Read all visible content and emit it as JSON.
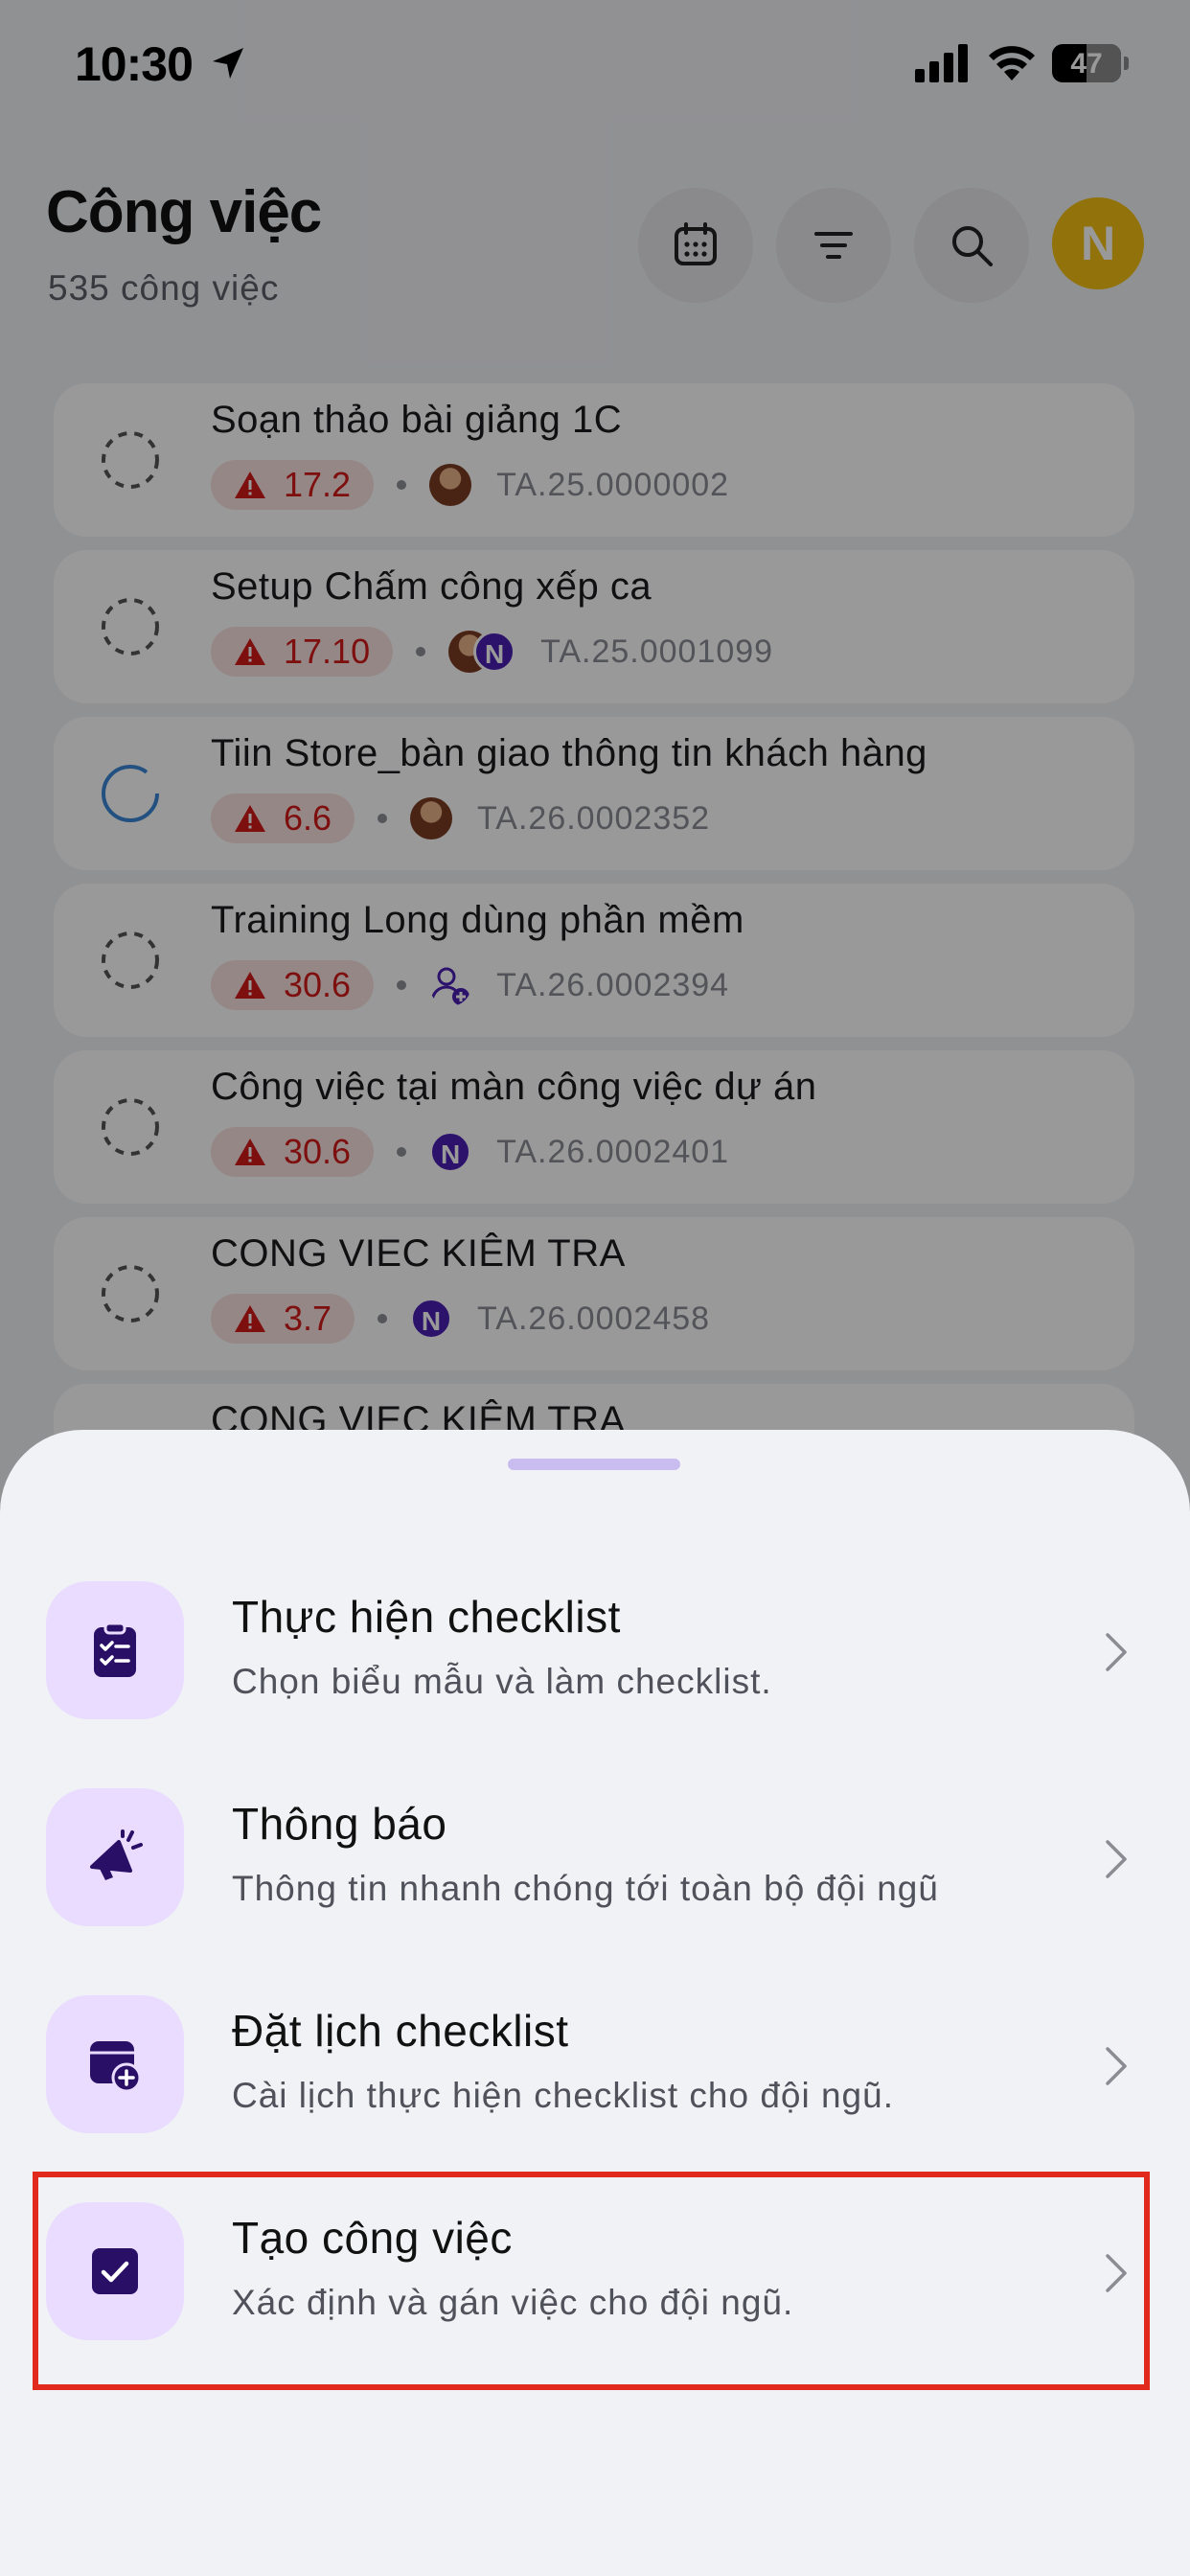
{
  "status_bar": {
    "time": "10:30",
    "battery": "47"
  },
  "header": {
    "title": "Công việc",
    "subtitle": "535 công việc",
    "buttons": [
      "calendar-icon",
      "filter-icon",
      "search-icon"
    ],
    "avatar_initial": "N"
  },
  "tasks": [
    {
      "title": "Soạn thảo bài giảng 1C",
      "deadline": "17.2",
      "code": "TA.25.0000002"
    },
    {
      "title": "Setup Chấm công xếp ca",
      "deadline": "17.10",
      "code": "TA.25.0001099"
    },
    {
      "title": "Tiin Store_bàn giao thông tin khách hàng",
      "deadline": "6.6",
      "code": "TA.26.0002352"
    },
    {
      "title": "Training Long dùng phần mềm",
      "deadline": "30.6",
      "code": "TA.26.0002394"
    },
    {
      "title": "Công việc tại màn công việc dự án",
      "deadline": "30.6",
      "code": "TA.26.0002401"
    },
    {
      "title": "CONG VIEC KIÊM TRA",
      "deadline": "3.7",
      "code": "TA.26.0002458"
    },
    {
      "title": "CONG VIEC KIÊM TRA"
    }
  ],
  "assignee_initial": "N",
  "sheet": {
    "options": [
      {
        "title": "Thực hiện checklist",
        "subtitle": "Chọn biểu mẫu và làm checklist.",
        "icon": "clipboard-checklist-icon"
      },
      {
        "title": "Thông báo",
        "subtitle": "Thông tin nhanh chóng tới toàn bộ đội ngũ",
        "icon": "megaphone-icon"
      },
      {
        "title": "Đặt lịch checklist",
        "subtitle": "Cài lịch thực hiện checklist cho đội ngũ.",
        "icon": "calendar-add-icon"
      },
      {
        "title": "Tạo công việc",
        "subtitle": "Xác định và gán việc cho đội ngũ.",
        "icon": "checkbox-icon"
      }
    ]
  },
  "colors": {
    "accent": "#4b1eb4",
    "icon_bg": "#eadcff",
    "deadline_text": "#d21a1a",
    "deadline_bg": "#fbe1e1",
    "highlight": "#e12a1c",
    "avatar_yellow": "#f4c013"
  }
}
